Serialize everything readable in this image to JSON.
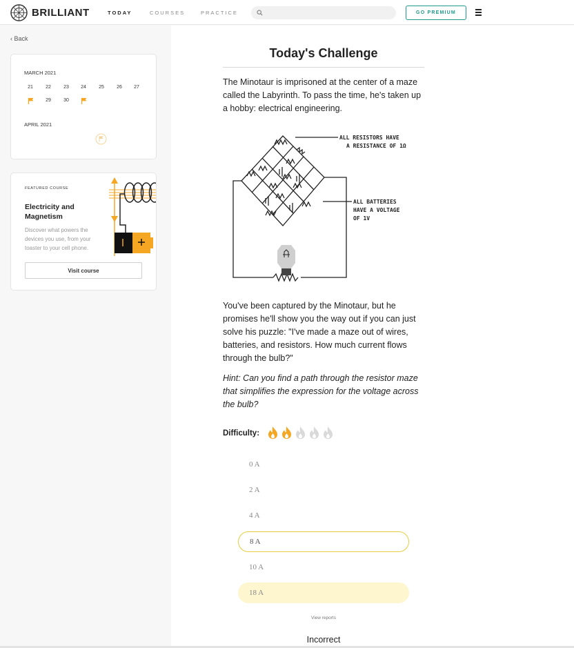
{
  "header": {
    "brand": "BRILLIANT",
    "nav": [
      {
        "label": "TODAY",
        "active": true
      },
      {
        "label": "COURSES",
        "active": false
      },
      {
        "label": "PRACTICE",
        "active": false
      }
    ],
    "search_placeholder": "",
    "premium_label": "GO PREMIUM"
  },
  "sidebar": {
    "back_label": "Back",
    "calendar": {
      "month1": "MARCH 2021",
      "row1": [
        "21",
        "22",
        "23",
        "24",
        "25",
        "26",
        "27"
      ],
      "row2": [
        "29",
        "30"
      ],
      "month2": "APRIL 2021"
    },
    "featured": {
      "kicker": "FEATURED COURSE",
      "title": "Electricity and Magnetism",
      "description": "Discover what powers the devices you use, from your toaster to your cell phone.",
      "button": "Visit course"
    }
  },
  "challenge": {
    "title": "Today's Challenge",
    "intro": "The Minotaur is imprisoned at the center of a maze called the Labyrinth. To pass the time, he's taken up a hobby: electrical engineering.",
    "figure_labels": {
      "resistors_1": "ALL RESISTORS HAVE",
      "resistors_2": "A RESISTANCE OF 1Ω",
      "batteries_1": "ALL BATTERIES",
      "batteries_2": "HAVE A VOLTAGE",
      "batteries_3": "OF 1V"
    },
    "question": "You've been captured by the Minotaur, but he promises he'll show you the way out if you can just solve his puzzle: \"I've made a maze out of wires, batteries, and resistors. How much current flows through the bulb?\"",
    "hint": "Hint: Can you find a path through the resistor maze that simplifies the expression for the voltage across the bulb?",
    "difficulty_label": "Difficulty:",
    "difficulty_level": 2,
    "difficulty_max": 5,
    "options": [
      "0 A",
      "2 A",
      "4 A",
      "8 A",
      "10 A",
      "18 A"
    ],
    "selected_option": "8 A",
    "correct_option": "18 A",
    "view_reports": "View reports",
    "result": "Incorrect"
  },
  "colors": {
    "accent": "#1e9a8a",
    "flame_active": "#f5a623",
    "flame_inactive": "#d9d9d9",
    "selected_border": "#e7cd3e",
    "answer_fill": "#fdf6cf"
  }
}
